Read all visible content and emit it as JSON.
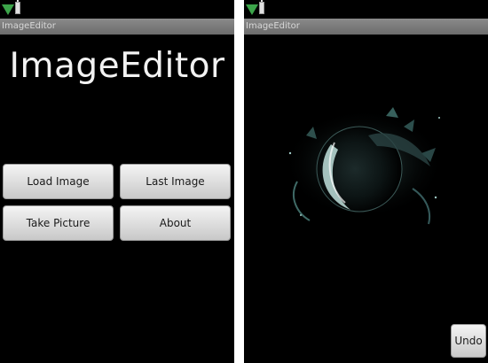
{
  "left_screen": {
    "window_title": "ImageEditor",
    "heading": "ImageEditor",
    "buttons": {
      "load_image": "Load Image",
      "last_image": "Last Image",
      "take_picture": "Take Picture",
      "about": "About"
    }
  },
  "right_screen": {
    "window_title": "ImageEditor",
    "undo_label": "Undo",
    "image_description": "edited planet photo"
  },
  "icons": {
    "signal": "signal-icon",
    "battery": "battery-icon"
  },
  "colors": {
    "screen_background": "#000000",
    "titlebar": "#7a7a7a",
    "signal_green": "#3ca44a",
    "button_face": "#dcdcdc"
  }
}
